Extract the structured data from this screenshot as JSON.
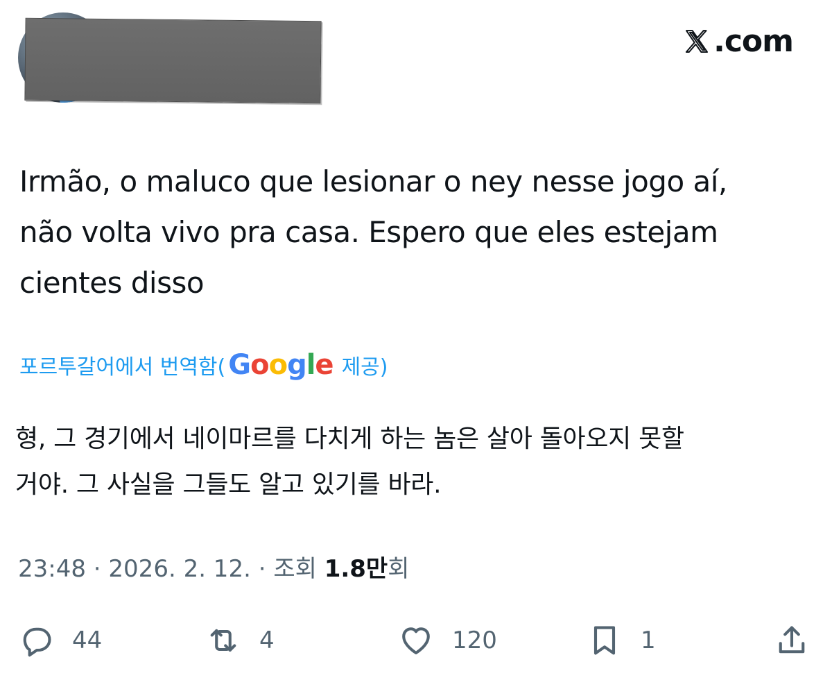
{
  "header": {
    "brand": "𝕏.com",
    "brand_text": ".com"
  },
  "tweet": {
    "text_lines": [
      "Irmão, o maluco que lesionar o ney nesse jogo aí,",
      "não volta vivo pra casa. Espero que eles estejam",
      "cientes disso"
    ],
    "translation": {
      "prefix": "포르투갈어에서 번역함(",
      "provider": "Google",
      "suffix": "제공)",
      "lines": [
        "형, 그 경기에서 네이마르를 다치게 하는 놈은 살아 돌아오지 못할",
        "거야. 그 사실을 그들도 알고 있기를 바라."
      ]
    },
    "meta": {
      "time": "23:48",
      "separator": " · ",
      "date": "2026. 2. 12.",
      "views_label": "조회 ",
      "views_count": "1.8만",
      "views_suffix": "회"
    }
  },
  "actions": {
    "reply": {
      "icon": "reply-bubble-icon",
      "count": "44"
    },
    "repost": {
      "icon": "repost-icon",
      "count": "4"
    },
    "like": {
      "icon": "heart-icon",
      "count": "120"
    },
    "bookmark": {
      "icon": "bookmark-icon",
      "count": "1"
    },
    "share": {
      "icon": "share-icon"
    }
  },
  "colors": {
    "text": "#0f1419",
    "secondary": "#536471",
    "link": "#1d9bf0",
    "google_blue": "#4285f4",
    "google_red": "#ea4335",
    "google_yellow": "#fbbc05",
    "google_green": "#34a853"
  }
}
